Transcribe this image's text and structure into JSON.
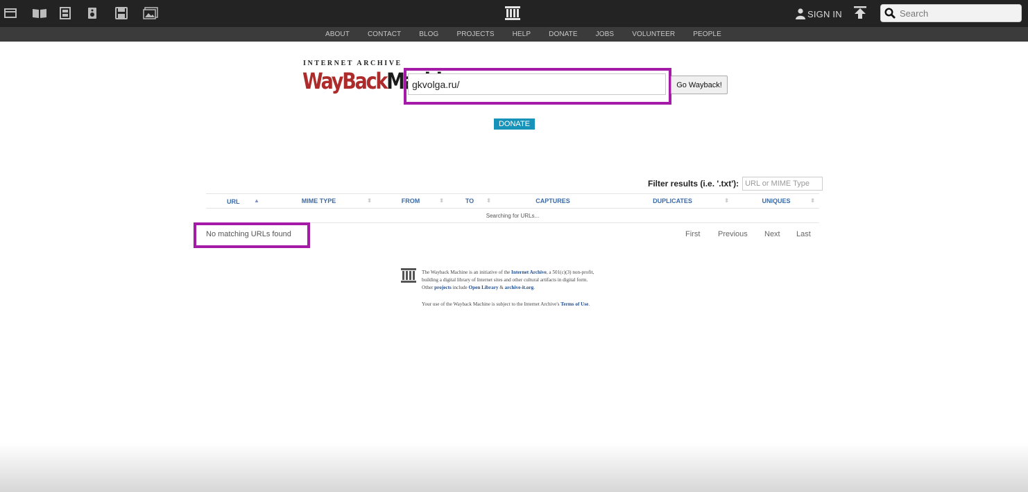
{
  "topbar": {
    "icons": [
      "web-icon",
      "texts-icon",
      "video-icon",
      "audio-icon",
      "software-icon",
      "images-icon"
    ],
    "center_logo": "archive-building-icon",
    "signin_label": "SIGN IN",
    "upload_icon": "upload-icon",
    "search_placeholder": "Search"
  },
  "navbar": {
    "items": [
      "ABOUT",
      "CONTACT",
      "BLOG",
      "PROJECTS",
      "HELP",
      "DONATE",
      "JOBS",
      "VOLUNTEER",
      "PEOPLE"
    ]
  },
  "wayback": {
    "logo_small": "INTERNET ARCHIVE",
    "logo_red": "WayBack",
    "logo_black": "Machine",
    "url_value": "gkvolga.ru/",
    "go_label": "Go Wayback!",
    "donate_label": "DONATE",
    "highlight_color": "#a61aa8"
  },
  "filter": {
    "label": "Filter results (i.e. '.txt'):",
    "placeholder": "URL or MIME Type"
  },
  "table": {
    "headers": [
      "URL",
      "MIME TYPE",
      "FROM",
      "TO",
      "CAPTURES",
      "DUPLICATES",
      "UNIQUES"
    ],
    "status_row": "Searching for URLs..."
  },
  "results": {
    "no_match": "No matching URLs found",
    "pager": [
      "First",
      "Previous",
      "Next",
      "Last"
    ]
  },
  "footer": {
    "line1_a": "The Wayback Machine is an initiative of the ",
    "line1_link": "Internet Archive",
    "line1_b": ", a 501(c)(3) non-profit,",
    "line2": "building a digital library of Internet sites and other cultural artifacts in digital form.",
    "line3_a": "Other ",
    "line3_link1": "projects",
    "line3_b": " include ",
    "line3_link2": "Open Library",
    "line3_c": " & ",
    "line3_link3": "archive-it.org",
    "line3_d": ".",
    "terms_a": "Your use of the Wayback Machine is subject to the Internet Archive's ",
    "terms_link": "Terms of Use",
    "terms_b": "."
  }
}
